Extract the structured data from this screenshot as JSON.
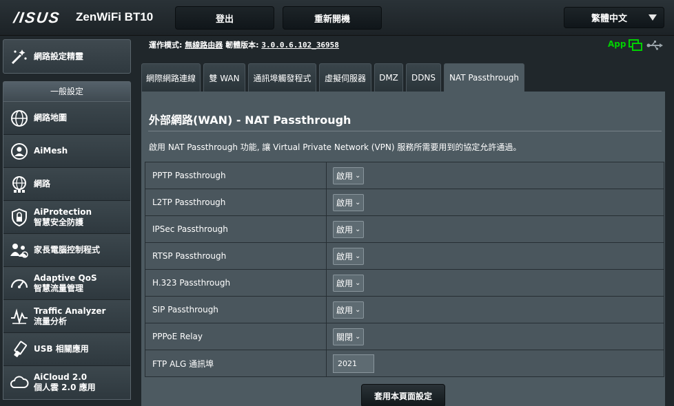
{
  "header": {
    "brand": "/ISUS",
    "model": "ZenWiFi BT10",
    "logout_label": "登出",
    "reboot_label": "重新開機",
    "language": "繁體中文"
  },
  "sidebar": {
    "quick_setup": "網路設定精靈",
    "section_title": "一般設定",
    "items": [
      {
        "line1": "網路地圖",
        "line2": ""
      },
      {
        "line1": "AiMesh",
        "line2": ""
      },
      {
        "line1": "網路",
        "line2": ""
      },
      {
        "line1": "AiProtection",
        "line2": "智慧安全防護"
      },
      {
        "line1": "家長電腦控制程式",
        "line2": ""
      },
      {
        "line1": "Adaptive QoS",
        "line2": "智慧流量管理"
      },
      {
        "line1": "Traffic Analyzer",
        "line2": "流量分析"
      },
      {
        "line1": "USB 相關應用",
        "line2": ""
      },
      {
        "line1": "AiCloud 2.0",
        "line2": "個人雲 2.0 應用"
      }
    ]
  },
  "info_bar": {
    "mode_label": "運作模式:",
    "mode_value": "無線路由器",
    "firmware_label": "韌體版本:",
    "firmware_value": "3.0.0.6.102_36958",
    "app_label": "App"
  },
  "tabs": [
    "網際網路連線",
    "雙 WAN",
    "通訊埠觸發程式",
    "虛擬伺服器",
    "DMZ",
    "DDNS",
    "NAT Passthrough"
  ],
  "active_tab": "NAT Passthrough",
  "main": {
    "title": "外部網路(WAN) - NAT Passthrough",
    "description": "啟用 NAT Passthrough 功能, 讓 Virtual Private Network (VPN) 服務所需要用到的協定允許通過。",
    "rows": [
      {
        "label": "PPTP Passthrough",
        "value": "啟用"
      },
      {
        "label": "L2TP Passthrough",
        "value": "啟用"
      },
      {
        "label": "IPSec Passthrough",
        "value": "啟用"
      },
      {
        "label": "RTSP Passthrough",
        "value": "啟用"
      },
      {
        "label": "H.323 Passthrough",
        "value": "啟用"
      },
      {
        "label": "SIP Passthrough",
        "value": "啟用"
      },
      {
        "label": "PPPoE Relay",
        "value": "關閉"
      }
    ],
    "ftp_label": "FTP ALG 通訊埠",
    "ftp_value": "2021",
    "apply_label": "套用本頁面設定"
  },
  "colors": {
    "background": "#20272b",
    "panel": "#4d5a61",
    "app_green": "#00d100"
  }
}
